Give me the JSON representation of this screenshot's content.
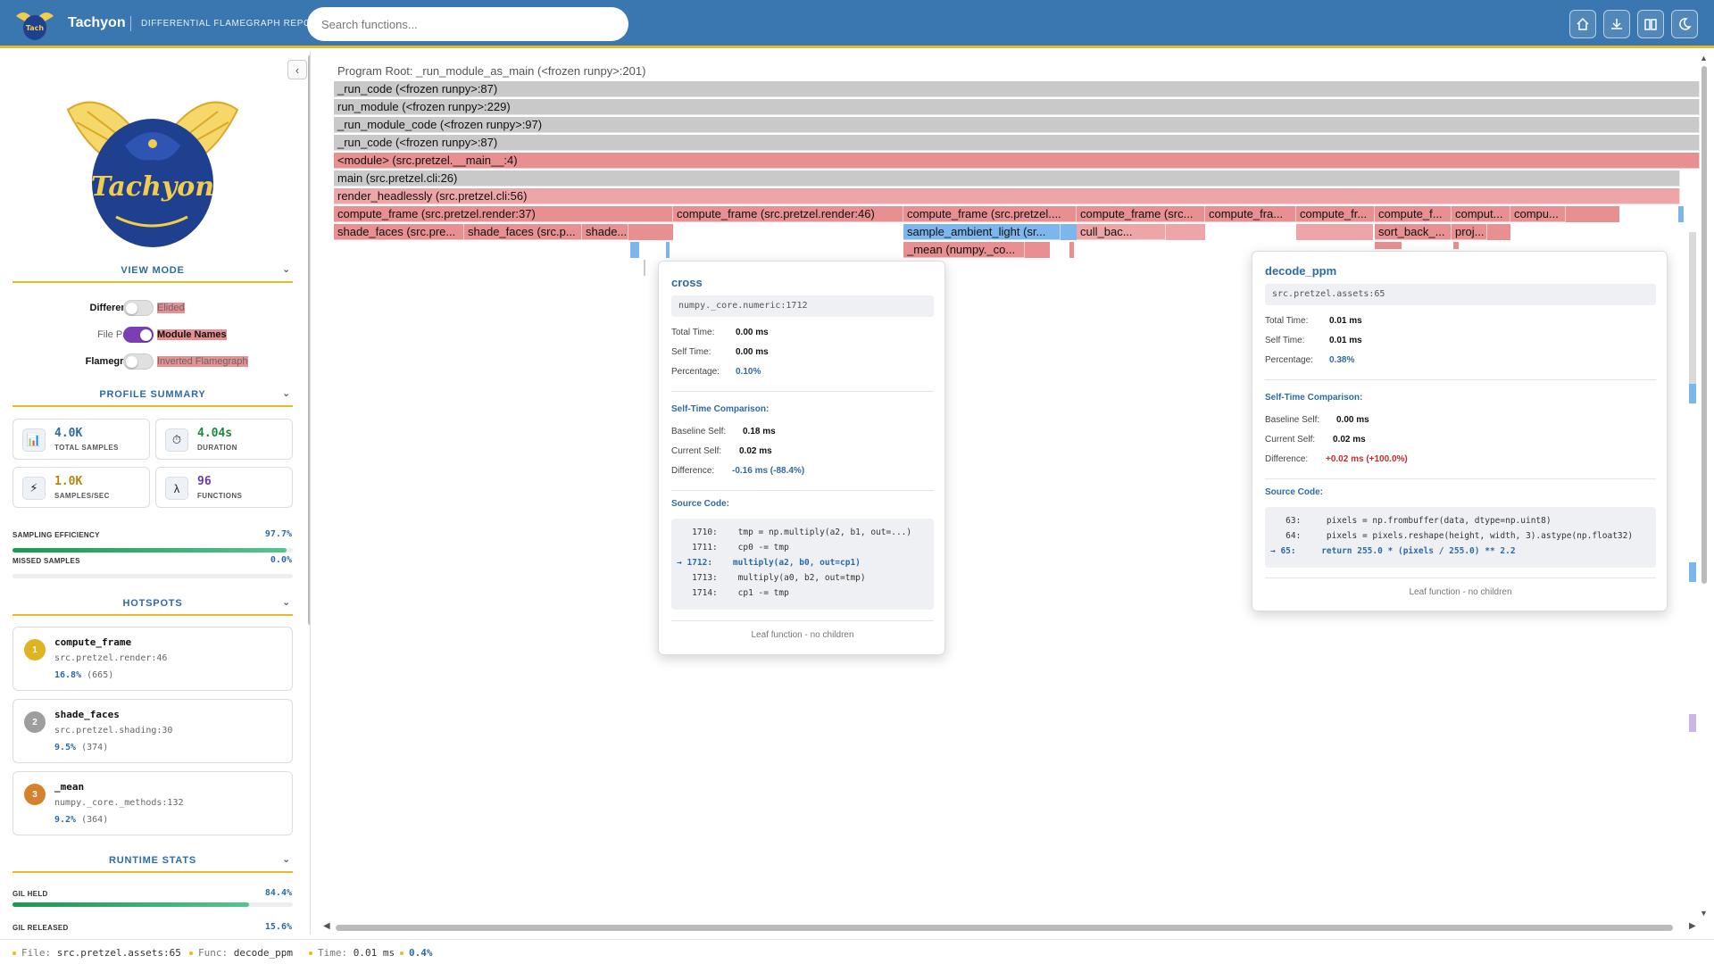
{
  "header": {
    "brand": "Tachyon",
    "subtitle": "DIFFERENTIAL FLAMEGRAPH REPORT",
    "search_placeholder": "Search functions...",
    "buttons": [
      "home-icon",
      "download-icon",
      "book-icon",
      "moon-icon"
    ]
  },
  "sidebar": {
    "collapse_label": "‹",
    "logo_text": "Tachyon",
    "view_mode": {
      "title": "VIEW MODE",
      "rows": [
        {
          "left": "Differential",
          "right": "Elided",
          "on": false,
          "bold": "left"
        },
        {
          "left": "File Paths",
          "right": "Module Names",
          "on": true,
          "bold": "right"
        },
        {
          "left": "Flamegraph",
          "right": "Inverted Flamegraph",
          "on": false,
          "bold": "left"
        }
      ]
    },
    "profile_summary": {
      "title": "PROFILE SUMMARY",
      "stats": [
        {
          "value": "4.0K",
          "label": "TOTAL SAMPLES",
          "icon": "bar-chart-icon",
          "color": "#2e6aa5"
        },
        {
          "value": "4.04s",
          "label": "DURATION",
          "icon": "stopwatch-icon",
          "color": "#1a8a3c"
        },
        {
          "value": "1.0K",
          "label": "SAMPLES/SEC",
          "icon": "lightning-icon",
          "color": "#b8860b"
        },
        {
          "value": "96",
          "label": "FUNCTIONS",
          "icon": "lambda-icon",
          "color": "#6a3ba8"
        }
      ],
      "sampling_efficiency_label": "SAMPLING EFFICIENCY",
      "sampling_efficiency": "97.7%",
      "sampling_efficiency_fraction": 0.977,
      "missed_samples_label": "MISSED SAMPLES",
      "missed_samples": "0.0%",
      "missed_samples_fraction": 0.0
    },
    "hotspots": {
      "title": "HOTSPOTS",
      "items": [
        {
          "rank": "1",
          "name": "compute_frame",
          "location": "src.pretzel.render:46",
          "percent": "16.8%",
          "count": "(665)",
          "color": "#e0b420"
        },
        {
          "rank": "2",
          "name": "shade_faces",
          "location": "src.pretzel.shading:30",
          "percent": "9.5%",
          "count": "(374)",
          "color": "#9e9e9e"
        },
        {
          "rank": "3",
          "name": "_mean",
          "location": "numpy._core._methods:132",
          "percent": "9.2%",
          "count": "(364)",
          "color": "#d4822e"
        }
      ]
    },
    "runtime_stats": {
      "title": "RUNTIME STATS",
      "gil_held_label": "GIL HELD",
      "gil_held": "84.4%",
      "gil_held_fraction": 0.844,
      "gil_released_label": "GIL RELEASED",
      "gil_released": "15.6%"
    }
  },
  "flamegraph": {
    "root_label": "Program Root: _run_module_as_main (<frozen runpy>:201)",
    "frames": [
      {
        "label": "_run_code (<frozen runpy>:87)",
        "cls": "g"
      },
      {
        "label": "run_module (<frozen runpy>:229)",
        "cls": "g"
      },
      {
        "label": "_run_module_code (<frozen runpy>:97)",
        "cls": "g"
      },
      {
        "label": "_run_code (<frozen runpy>:87)",
        "cls": "g"
      },
      {
        "label": "<module> (src.pretzel.__main__:4)",
        "cls": "r"
      },
      {
        "label": "main (src.pretzel.cli:26)",
        "cls": "g"
      },
      {
        "label": "render_headlessly (src.pretzel.cli:56)",
        "cls": "rl"
      },
      {
        "label": "compute_frame (src.pretzel.render:37)",
        "cls": "r"
      },
      {
        "label": "compute_frame (src.pretzel.render:46)",
        "cls": "r"
      },
      {
        "label": "compute_frame (src.pretzel....",
        "cls": "r"
      },
      {
        "label": "compute_frame (src...",
        "cls": "r"
      },
      {
        "label": "compute_fra...",
        "cls": "r"
      },
      {
        "label": "compute_fr...",
        "cls": "r"
      },
      {
        "label": "compute_f...",
        "cls": "r"
      },
      {
        "label": "comput...",
        "cls": "r"
      },
      {
        "label": "compu...",
        "cls": "r"
      },
      {
        "label": "shade_faces (src.pre...",
        "cls": "r"
      },
      {
        "label": "shade_faces (src.p...",
        "cls": "r"
      },
      {
        "label": "shade...",
        "cls": "r"
      },
      {
        "label": "sample_ambient_light (sr...",
        "cls": "bl"
      },
      {
        "label": "cull_bac...",
        "cls": "rl"
      },
      {
        "label": "sort_back_...",
        "cls": "r"
      },
      {
        "label": "proj...",
        "cls": "r"
      },
      {
        "label": "_mean (numpy._co...",
        "cls": "r"
      }
    ]
  },
  "tooltip_cross": {
    "name": "cross",
    "location": "numpy._core.numeric:1712",
    "total_time_label": "Total Time:",
    "total_time": "0.00 ms",
    "self_time_label": "Self Time:",
    "self_time": "0.00 ms",
    "percentage_label": "Percentage:",
    "percentage": "0.10%",
    "comparison_title": "Self-Time Comparison:",
    "baseline_label": "Baseline Self:",
    "baseline": "0.18 ms",
    "current_label": "Current Self:",
    "current": "0.02 ms",
    "difference_label": "Difference:",
    "difference": "-0.16 ms (-88.4%)",
    "source_title": "Source Code:",
    "code": [
      "   1710:    tmp = np.multiply(a2, b1, out=...)",
      "   1711:    cp0 -= tmp",
      "→ 1712:    multiply(a2, b0, out=cp1)",
      "   1713:    multiply(a0, b2, out=tmp)",
      "   1714:    cp1 -= tmp"
    ],
    "leaf": "Leaf function - no children"
  },
  "tooltip_decode": {
    "name": "decode_ppm",
    "location": "src.pretzel.assets:65",
    "total_time_label": "Total Time:",
    "total_time": "0.01 ms",
    "self_time_label": "Self Time:",
    "self_time": "0.01 ms",
    "percentage_label": "Percentage:",
    "percentage": "0.38%",
    "comparison_title": "Self-Time Comparison:",
    "baseline_label": "Baseline Self:",
    "baseline": "0.00 ms",
    "current_label": "Current Self:",
    "current": "0.02 ms",
    "difference_label": "Difference:",
    "difference": "+0.02 ms (+100.0%)",
    "source_title": "Source Code:",
    "code": [
      "   63:     pixels = np.frombuffer(data, dtype=np.uint8)",
      "   64:     pixels = pixels.reshape(height, width, 3).astype(np.float32)",
      "→ 65:     return 255.0 * (pixels / 255.0) ** 2.2"
    ],
    "leaf": "Leaf function - no children"
  },
  "statusbar": {
    "file_label": "File:",
    "file": "src.pretzel.assets:65",
    "func_label": "Func:",
    "func": "decode_ppm",
    "time_label": "Time:",
    "time": "0.01 ms",
    "percent": "0.4%"
  }
}
